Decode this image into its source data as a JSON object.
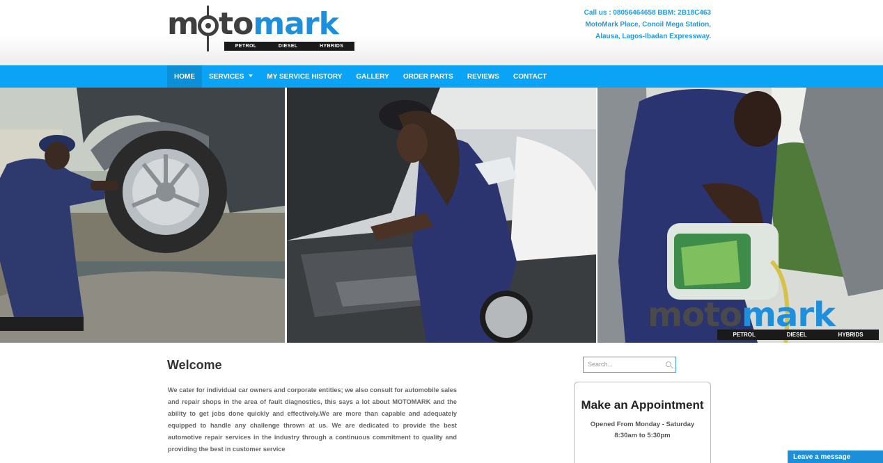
{
  "brand": {
    "logo_part1": "moto",
    "logo_part2": "mark",
    "tagline": [
      "PETROL",
      "DIESEL",
      "HYBRIDS"
    ],
    "colors": {
      "grey": "#3f3f3f",
      "blue": "#1e8fdc",
      "nav": "#0aa3f5"
    }
  },
  "contact": {
    "line1": "Call us : 08056464658 BBM: 2B18C463",
    "line2": "MotoMark Place, Conoil Mega Station,",
    "line3": "Alausa, Lagos-Ibadan Expressway."
  },
  "nav": {
    "items": [
      {
        "label": "HOME",
        "active": true
      },
      {
        "label": "SERVICES",
        "has_dropdown": true
      },
      {
        "label": "MY SERVICE HISTORY"
      },
      {
        "label": "GALLERY"
      },
      {
        "label": "ORDER PARTS"
      },
      {
        "label": "REVIEWS"
      },
      {
        "label": "CONTACT"
      }
    ]
  },
  "hero": {
    "logo_part1": "moto",
    "logo_part2": "mark",
    "tagline": [
      "PETROL",
      "DIESEL",
      "HYBRIDS"
    ]
  },
  "main": {
    "title": "Welcome",
    "body": "We cater for individual car owners and corporate entities; we also consult for automobile sales and repair shops in the area of fault diagnostics, this says a lot about MOTOMARK and the ability to get jobs done quickly and effectively.We are more than capable and adequately equipped to handle any challenge thrown at us. We are dedicated to provide the best automotive repair services in the industry through a continuous commitment to quality and providing the best in customer service"
  },
  "sidebar": {
    "search_placeholder": "Search...",
    "appointment_title": "Make an Appointment",
    "hours_line1": "Opened From Monday - Saturday",
    "hours_line2": "8:30am to 5:30pm"
  },
  "chat": {
    "label": "Leave a message"
  }
}
